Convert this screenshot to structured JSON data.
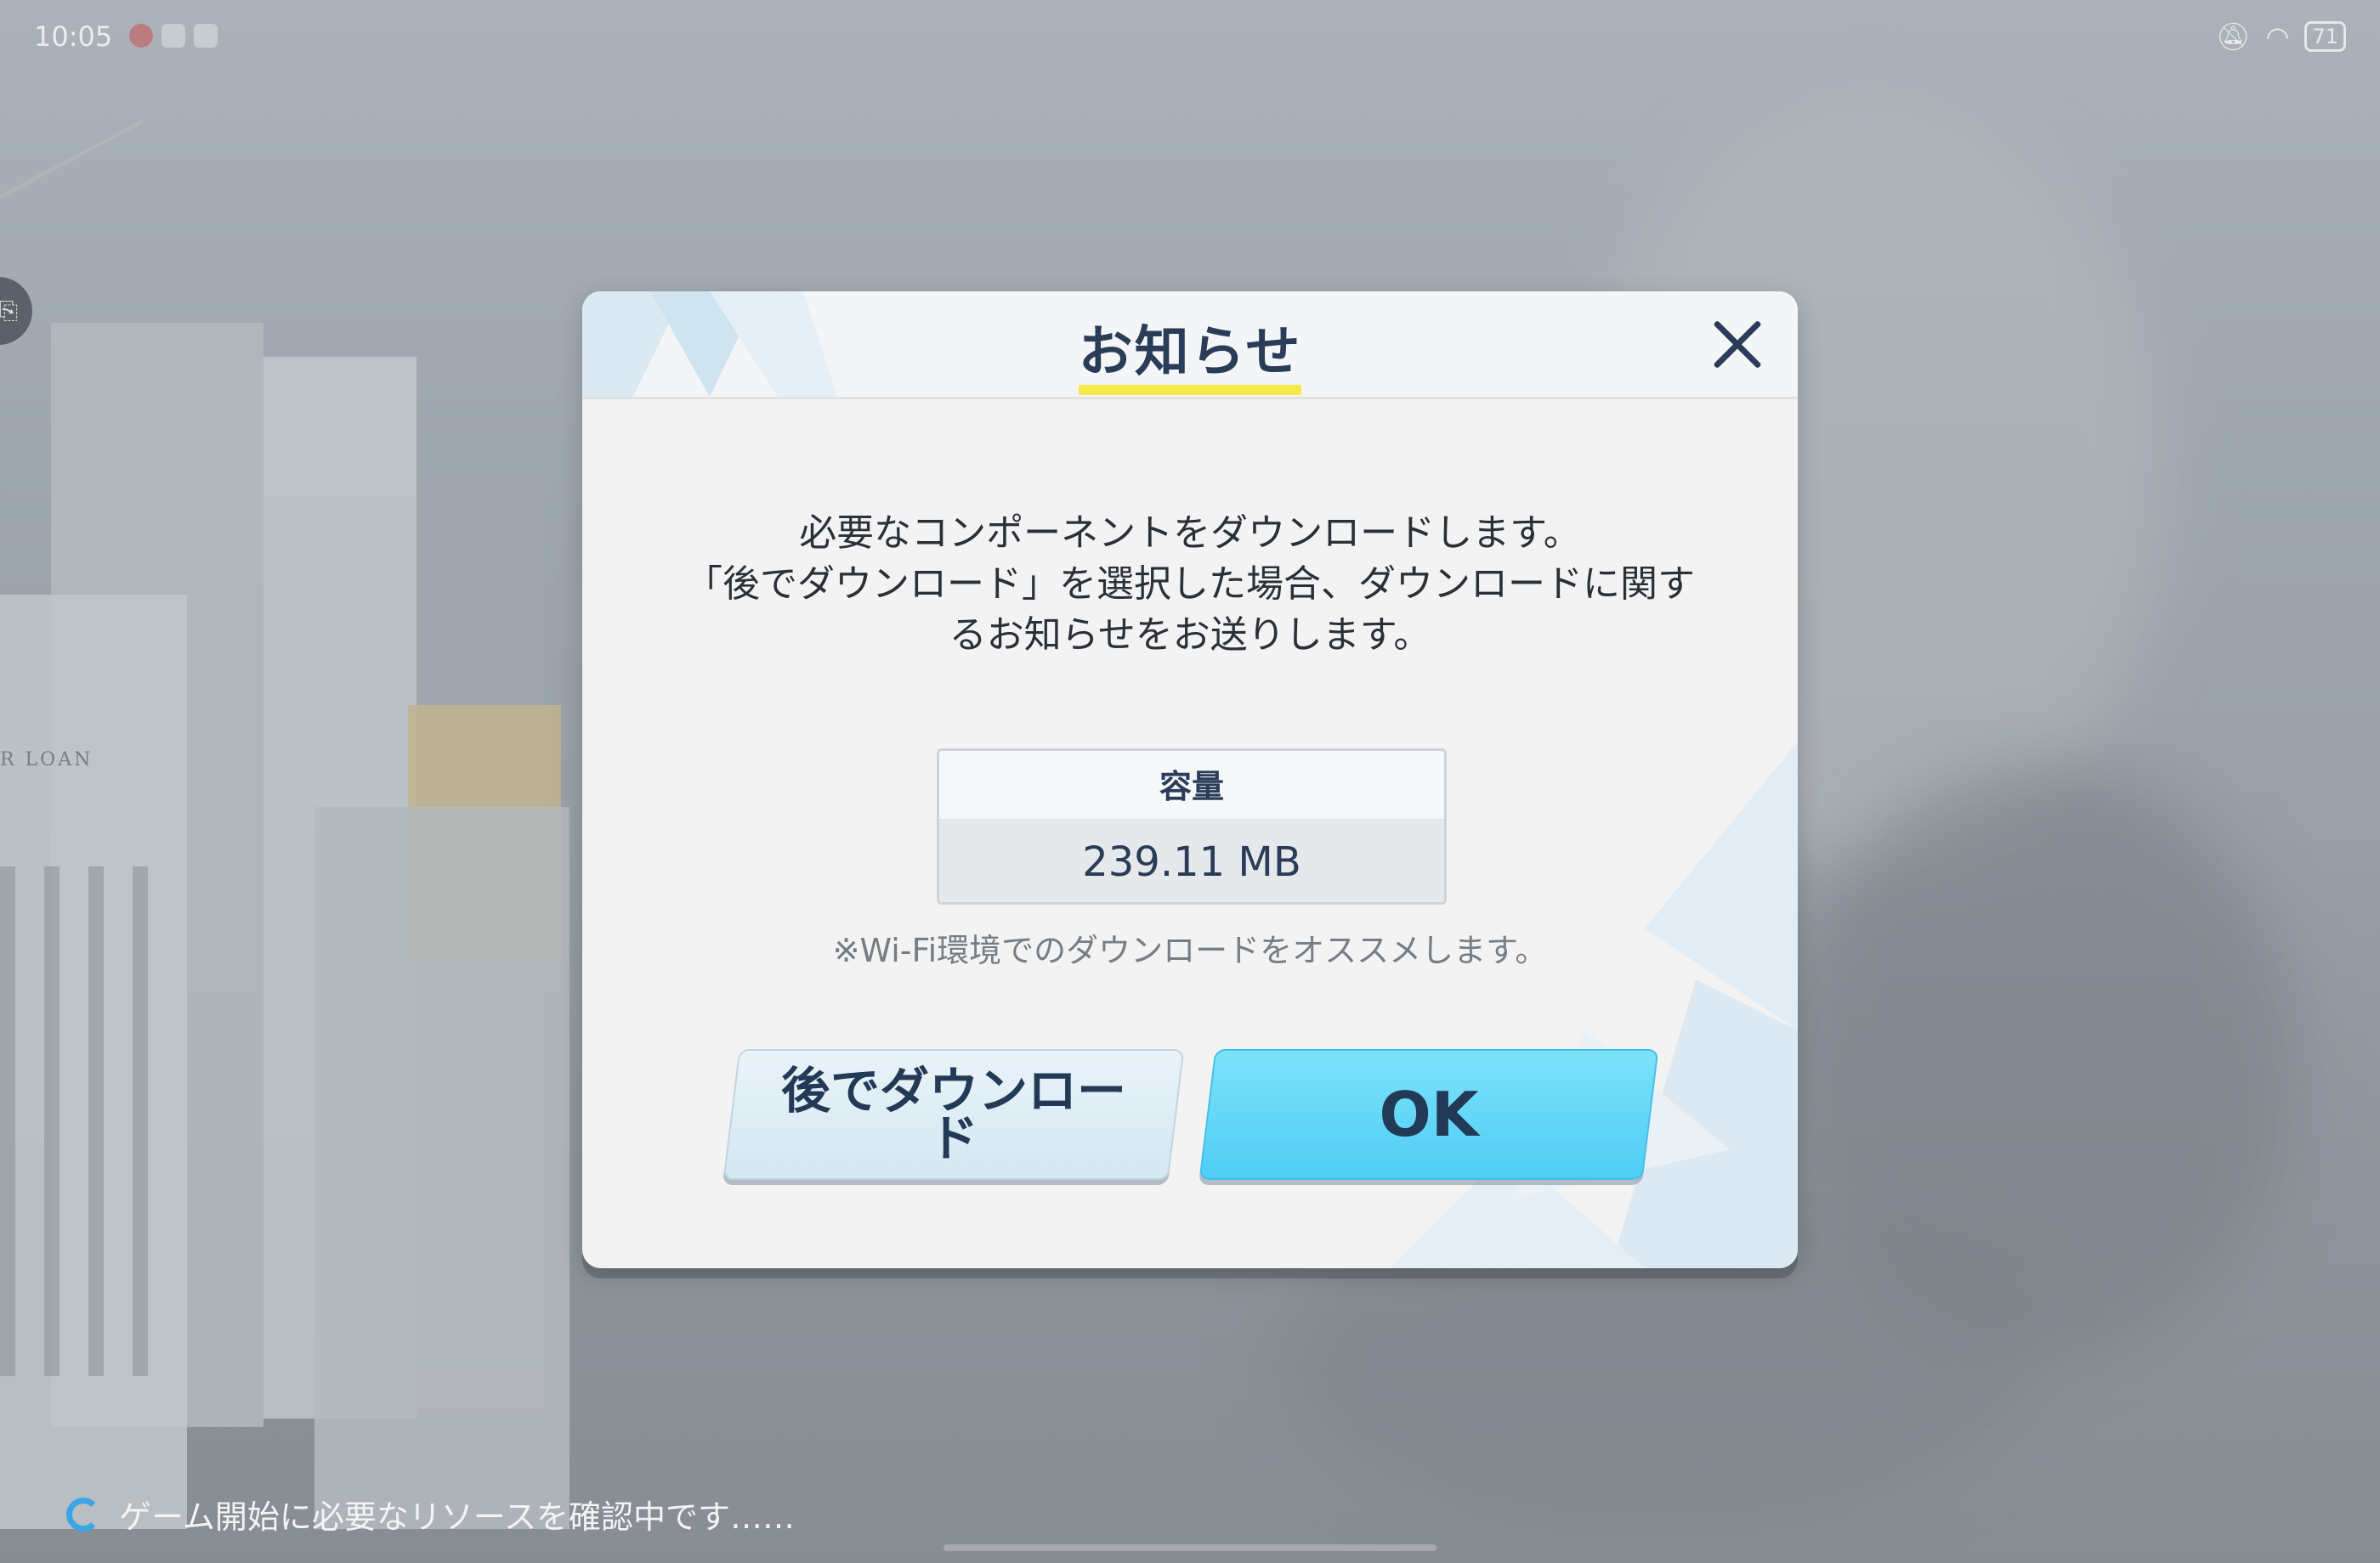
{
  "status_bar": {
    "time": "10:05",
    "battery": "71"
  },
  "dialog": {
    "title": "お知らせ",
    "message_lines": [
      "必要なコンポーネントをダウンロードします。",
      "「後でダウンロード」を選択した場合、ダウンロードに関す",
      "るお知らせをお送りします。"
    ],
    "size_label": "容量",
    "size_value": "239.11 MB",
    "note": "※Wi-Fi環境でのダウンロードをオススメします。",
    "later_button": "後でダウンロード",
    "ok_button": "OK"
  },
  "loading_text": "ゲーム開始に必要なリソースを確認中です……",
  "background_sign": "R LOAN",
  "colors": {
    "title": "#2a3c58",
    "underline": "#f6e847",
    "ok_button": "#5fd6f7",
    "later_button": "#dbedf5",
    "spinner": "#3aa6e6"
  },
  "icons": {
    "close": "close-icon",
    "spinner": "loading-spinner-icon",
    "side_tab": "translate-icon"
  }
}
